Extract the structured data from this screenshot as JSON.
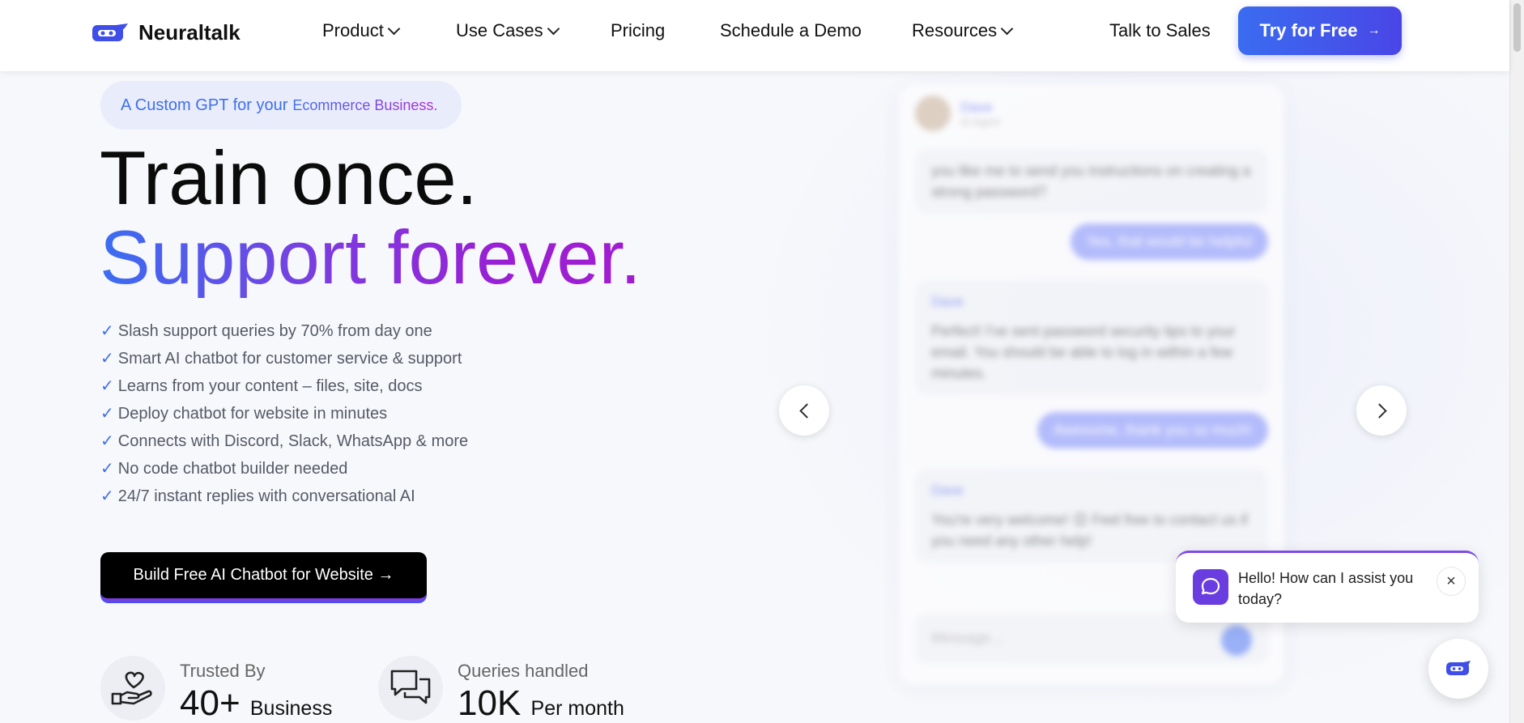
{
  "header": {
    "brand": "Neuraltalk",
    "nav": [
      {
        "label": "Product",
        "dropdown": true
      },
      {
        "label": "Use Cases",
        "dropdown": true
      },
      {
        "label": "Pricing",
        "dropdown": false
      },
      {
        "label": "Schedule a Demo",
        "dropdown": false
      },
      {
        "label": "Resources",
        "dropdown": true
      }
    ],
    "talk_to_sales": "Talk to Sales",
    "try_free": "Try for Free",
    "try_free_arrow": "→"
  },
  "hero": {
    "tag_prefix": "A Custom GPT for your",
    "tag_highlight": "Ecommerce Business.",
    "title_line1": "Train once.",
    "title_line2": "Support forever.",
    "check_glyph": "✓",
    "bullets": [
      "Slash support queries by 70% from day one",
      "Smart AI chatbot for customer service & support",
      "Learns from your content – files, site, docs",
      "Deploy chatbot for website in minutes",
      "Connects with Discord, Slack, WhatsApp & more",
      "No code chatbot builder needed",
      "24/7 instant replies with conversational AI"
    ],
    "cta": "Build Free AI Chatbot for Website →"
  },
  "stats": [
    {
      "label": "Trusted By",
      "value": "40+",
      "unit": "Business",
      "icon": "heart-hand-icon"
    },
    {
      "label": "Queries handled",
      "value": "10K",
      "unit": "Per month",
      "icon": "chat-bubbles-icon"
    }
  ],
  "chat_preview": {
    "agent_name": "Dave",
    "agent_sub": "AI Agent",
    "msg_top": "you like me to send you instructions on creating a strong password?",
    "user_1": "Yes, that would be helpful",
    "bot_1_name": "Dave",
    "bot_1": "Perfect! I've sent password security tips to your email. You should be able to log in within a few minutes.",
    "user_2": "Awesome, thank you so much!",
    "bot_2_name": "Dave",
    "bot_2": "You're very welcome! 😊 Feel free to contact us if you need any other help!",
    "input_placeholder": "Message..."
  },
  "chat_popup": {
    "message": "Hello! How can I assist you today?",
    "close": "×"
  },
  "colors": {
    "brand_blue": "#3a6cf0",
    "brand_purple": "#a21cd0"
  }
}
